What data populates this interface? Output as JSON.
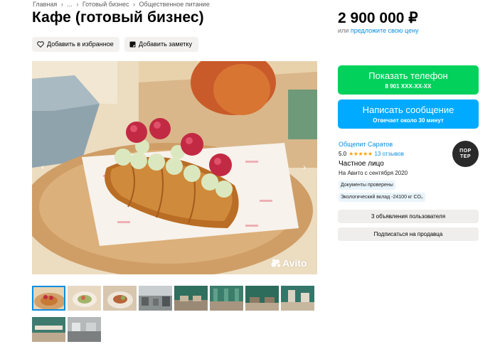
{
  "breadcrumb": {
    "items": [
      "Главная",
      "...",
      "Готовый бизнес",
      "Общественное питание"
    ],
    "separator": "›"
  },
  "title": "Кафе (готовый бизнес)",
  "actions": {
    "favorite_label": "Добавить в избранное",
    "note_label": "Добавить заметку"
  },
  "price": {
    "value": "2 900 000 ₽",
    "or": "или",
    "offer_link": "предложите свою цену"
  },
  "gallery": {
    "watermark": "Avito",
    "arrow_left": "‹",
    "arrow_right": "›"
  },
  "contact": {
    "call_label": "Показать телефон",
    "phone": "8 901 XXX-XX-XX",
    "message_label": "Написать сообщение",
    "reply_time": "Отвечает около 30 минут"
  },
  "seller": {
    "name": "Общепит Саратов",
    "rating": "5.0",
    "stars": "★★★★★",
    "reviews": "13 отзывов",
    "type": "Частное лицо",
    "since": "На Авито с сентября 2020",
    "badge_docs": "Документы проверены",
    "badge_eco": "Экологический вклад -24100 кг CO₂",
    "avatar_line1": "ПОР",
    "avatar_line2": "ТЕР"
  },
  "seller_actions": {
    "ads_label": "3 объявления пользователя",
    "subscribe_label": "Подписаться на продавца"
  },
  "colors": {
    "green": "#02d15c",
    "blue": "#00aaff",
    "link": "#0a8ee0",
    "star": "#ffa200"
  }
}
